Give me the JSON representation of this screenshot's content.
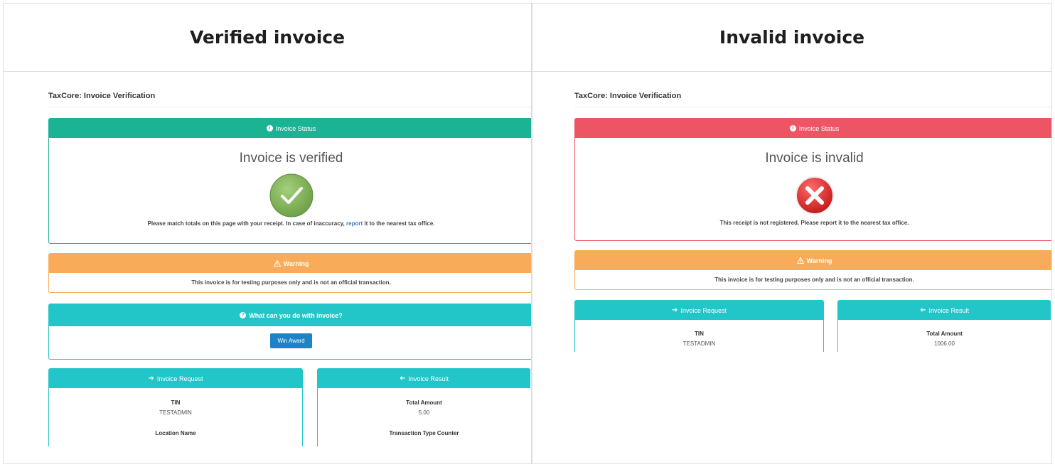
{
  "headers": {
    "left": "Verified invoice",
    "right": "Invalid invoice"
  },
  "verified": {
    "app_title": "TaxCore: Invoice Verification",
    "status_panel": {
      "title": "Invoice Status",
      "icon": "info-icon",
      "color": "#1ab394"
    },
    "status_text": "Invoice is verified",
    "badge_icon": "check-circle-icon",
    "note_before": "Please match totals on this page with your receipt. In case of inaccuracy,",
    "note_link": "report",
    "note_after": "it to the nearest tax office.",
    "warning_panel": {
      "title": "Warning",
      "icon": "warning-icon",
      "color": "#f8ac59"
    },
    "warning_text": "This invoice is for testing purposes only and is not an official transaction.",
    "action_panel": {
      "title": "What can you do with invoice?",
      "icon": "question-icon"
    },
    "action_button": "Win Award",
    "request": {
      "title": "Invoice Request",
      "icon": "arrow-right-icon",
      "fields": [
        {
          "label": "TIN",
          "value": "TESTADMIN"
        },
        {
          "label": "Location Name",
          "value": ""
        }
      ]
    },
    "result": {
      "title": "Invoice Result",
      "icon": "arrow-left-icon",
      "fields": [
        {
          "label": "Total Amount",
          "value": "5.00"
        },
        {
          "label": "Transaction Type Counter",
          "value": ""
        }
      ]
    }
  },
  "invalid": {
    "app_title": "TaxCore: Invoice Verification",
    "status_panel": {
      "title": "Invoice Status",
      "icon": "info-icon",
      "color": "#ed5565"
    },
    "status_text": "Invoice is invalid",
    "badge_icon": "x-circle-icon",
    "note": "This receipt is not registered. Please report it to the nearest tax office.",
    "warning_panel": {
      "title": "Warning",
      "icon": "warning-icon"
    },
    "warning_text": "This invoice is for testing purposes only and is not an official transaction.",
    "request": {
      "title": "Invoice Request",
      "icon": "arrow-right-icon",
      "fields": [
        {
          "label": "TIN",
          "value": "TESTADMIN"
        }
      ]
    },
    "result": {
      "title": "Invoice Result",
      "icon": "arrow-left-icon",
      "fields": [
        {
          "label": "Total Amount",
          "value": "1006.00"
        }
      ]
    }
  }
}
